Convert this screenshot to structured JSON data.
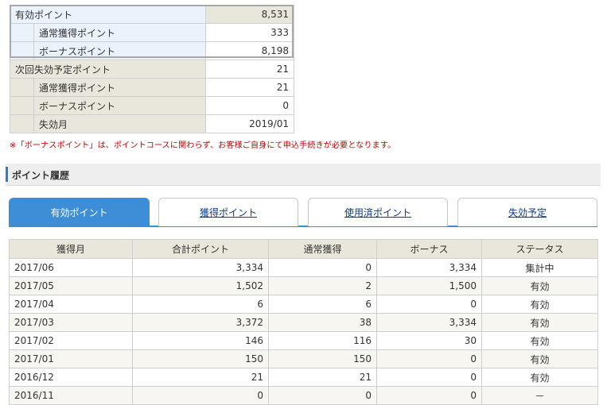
{
  "summary": {
    "valid": {
      "label": "有効ポイント",
      "value": "8,531"
    },
    "valid_normal": {
      "label": "通常獲得ポイント",
      "value": "333"
    },
    "valid_bonus": {
      "label": "ボーナスポイント",
      "value": "8,198"
    },
    "next_expire": {
      "label": "次回失効予定ポイント",
      "value": "21"
    },
    "expire_normal": {
      "label": "通常獲得ポイント",
      "value": "21"
    },
    "expire_bonus": {
      "label": "ボーナスポイント",
      "value": "0"
    },
    "expire_month": {
      "label": "失効月",
      "value": "2019/01"
    }
  },
  "note": "※「ボーナスポイント」は、ポイントコースに関わらず、お客様ご自身にて申込手続きが必要となります。",
  "section_title": "ポイント履歴",
  "tabs": [
    {
      "label": "有効ポイント",
      "active": true
    },
    {
      "label": "獲得ポイント",
      "active": false
    },
    {
      "label": "使用済ポイント",
      "active": false
    },
    {
      "label": "失効予定",
      "active": false
    }
  ],
  "history": {
    "headers": [
      "獲得月",
      "合計ポイント",
      "通常獲得",
      "ボーナス",
      "ステータス"
    ],
    "rows": [
      [
        "2017/06",
        "3,334",
        "0",
        "3,334",
        "集計中"
      ],
      [
        "2017/05",
        "1,502",
        "2",
        "1,500",
        "有効"
      ],
      [
        "2017/04",
        "6",
        "6",
        "0",
        "有効"
      ],
      [
        "2017/03",
        "3,372",
        "38",
        "3,334",
        "有効"
      ],
      [
        "2017/02",
        "146",
        "116",
        "30",
        "有効"
      ],
      [
        "2017/01",
        "150",
        "150",
        "0",
        "有効"
      ],
      [
        "2016/12",
        "21",
        "21",
        "0",
        "有効"
      ],
      [
        "2016/11",
        "0",
        "0",
        "0",
        "－"
      ]
    ]
  }
}
